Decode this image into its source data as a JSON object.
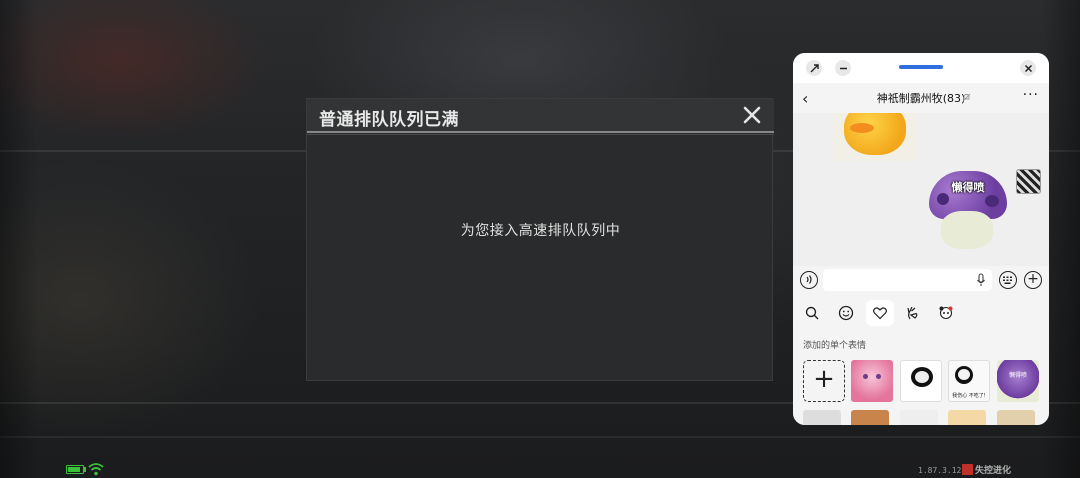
{
  "game": {
    "dialog": {
      "title": "普通排队队列已满",
      "message": "为您接入高速排队队列中",
      "close_icon": "close-x-icon"
    },
    "status": {
      "battery_level": 0.85,
      "battery_color": "#3ac23a",
      "wifi_color": "#3ac23a"
    },
    "footer": {
      "version": "1.87.3.1281",
      "brand": "失控进化"
    }
  },
  "chat": {
    "window_controls": {
      "left_1": "pip-icon",
      "left_2": "minimize-icon",
      "right": "close-icon",
      "handle_color": "#2f6fe0"
    },
    "header": {
      "back": "‹",
      "title": "神祇制霸州牧(83)",
      "more": "···"
    },
    "messages": [
      {
        "from": "other",
        "type": "sticker",
        "name": "duck-sticker"
      },
      {
        "from": "me",
        "type": "sticker",
        "name": "mushroom-sticker",
        "text": "懒得喷"
      }
    ],
    "input": {
      "placeholder": "",
      "value": ""
    },
    "emoji_tabs": [
      "search",
      "smiley",
      "favorites",
      "hand-gesture",
      "panda-character"
    ],
    "emoji_active_tab": "favorites",
    "sticker_section_label": "添加的单个表情",
    "sticker_thumbs": [
      {
        "name": "anime-girl-sticker",
        "text": ""
      },
      {
        "name": "panda-meme-sticker",
        "text": ""
      },
      {
        "name": "panda-meme-sticker-2",
        "text": "我伤心 不吃了!"
      },
      {
        "name": "mushroom-sticker-thumb",
        "text": "懒得喷"
      }
    ]
  }
}
